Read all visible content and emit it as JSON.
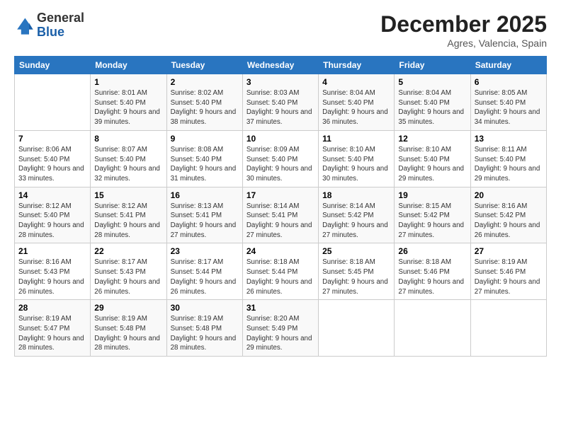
{
  "logo": {
    "general": "General",
    "blue": "Blue"
  },
  "header": {
    "month": "December 2025",
    "location": "Agres, Valencia, Spain"
  },
  "days_of_week": [
    "Sunday",
    "Monday",
    "Tuesday",
    "Wednesday",
    "Thursday",
    "Friday",
    "Saturday"
  ],
  "weeks": [
    [
      {
        "day": "",
        "sunrise": "",
        "sunset": "",
        "daylight": ""
      },
      {
        "day": "1",
        "sunrise": "8:01 AM",
        "sunset": "5:40 PM",
        "daylight": "9 hours and 39 minutes."
      },
      {
        "day": "2",
        "sunrise": "8:02 AM",
        "sunset": "5:40 PM",
        "daylight": "9 hours and 38 minutes."
      },
      {
        "day": "3",
        "sunrise": "8:03 AM",
        "sunset": "5:40 PM",
        "daylight": "9 hours and 37 minutes."
      },
      {
        "day": "4",
        "sunrise": "8:04 AM",
        "sunset": "5:40 PM",
        "daylight": "9 hours and 36 minutes."
      },
      {
        "day": "5",
        "sunrise": "8:04 AM",
        "sunset": "5:40 PM",
        "daylight": "9 hours and 35 minutes."
      },
      {
        "day": "6",
        "sunrise": "8:05 AM",
        "sunset": "5:40 PM",
        "daylight": "9 hours and 34 minutes."
      }
    ],
    [
      {
        "day": "7",
        "sunrise": "8:06 AM",
        "sunset": "5:40 PM",
        "daylight": "9 hours and 33 minutes."
      },
      {
        "day": "8",
        "sunrise": "8:07 AM",
        "sunset": "5:40 PM",
        "daylight": "9 hours and 32 minutes."
      },
      {
        "day": "9",
        "sunrise": "8:08 AM",
        "sunset": "5:40 PM",
        "daylight": "9 hours and 31 minutes."
      },
      {
        "day": "10",
        "sunrise": "8:09 AM",
        "sunset": "5:40 PM",
        "daylight": "9 hours and 30 minutes."
      },
      {
        "day": "11",
        "sunrise": "8:10 AM",
        "sunset": "5:40 PM",
        "daylight": "9 hours and 30 minutes."
      },
      {
        "day": "12",
        "sunrise": "8:10 AM",
        "sunset": "5:40 PM",
        "daylight": "9 hours and 29 minutes."
      },
      {
        "day": "13",
        "sunrise": "8:11 AM",
        "sunset": "5:40 PM",
        "daylight": "9 hours and 29 minutes."
      }
    ],
    [
      {
        "day": "14",
        "sunrise": "8:12 AM",
        "sunset": "5:40 PM",
        "daylight": "9 hours and 28 minutes."
      },
      {
        "day": "15",
        "sunrise": "8:12 AM",
        "sunset": "5:41 PM",
        "daylight": "9 hours and 28 minutes."
      },
      {
        "day": "16",
        "sunrise": "8:13 AM",
        "sunset": "5:41 PM",
        "daylight": "9 hours and 27 minutes."
      },
      {
        "day": "17",
        "sunrise": "8:14 AM",
        "sunset": "5:41 PM",
        "daylight": "9 hours and 27 minutes."
      },
      {
        "day": "18",
        "sunrise": "8:14 AM",
        "sunset": "5:42 PM",
        "daylight": "9 hours and 27 minutes."
      },
      {
        "day": "19",
        "sunrise": "8:15 AM",
        "sunset": "5:42 PM",
        "daylight": "9 hours and 27 minutes."
      },
      {
        "day": "20",
        "sunrise": "8:16 AM",
        "sunset": "5:42 PM",
        "daylight": "9 hours and 26 minutes."
      }
    ],
    [
      {
        "day": "21",
        "sunrise": "8:16 AM",
        "sunset": "5:43 PM",
        "daylight": "9 hours and 26 minutes."
      },
      {
        "day": "22",
        "sunrise": "8:17 AM",
        "sunset": "5:43 PM",
        "daylight": "9 hours and 26 minutes."
      },
      {
        "day": "23",
        "sunrise": "8:17 AM",
        "sunset": "5:44 PM",
        "daylight": "9 hours and 26 minutes."
      },
      {
        "day": "24",
        "sunrise": "8:18 AM",
        "sunset": "5:44 PM",
        "daylight": "9 hours and 26 minutes."
      },
      {
        "day": "25",
        "sunrise": "8:18 AM",
        "sunset": "5:45 PM",
        "daylight": "9 hours and 27 minutes."
      },
      {
        "day": "26",
        "sunrise": "8:18 AM",
        "sunset": "5:46 PM",
        "daylight": "9 hours and 27 minutes."
      },
      {
        "day": "27",
        "sunrise": "8:19 AM",
        "sunset": "5:46 PM",
        "daylight": "9 hours and 27 minutes."
      }
    ],
    [
      {
        "day": "28",
        "sunrise": "8:19 AM",
        "sunset": "5:47 PM",
        "daylight": "9 hours and 28 minutes."
      },
      {
        "day": "29",
        "sunrise": "8:19 AM",
        "sunset": "5:48 PM",
        "daylight": "9 hours and 28 minutes."
      },
      {
        "day": "30",
        "sunrise": "8:19 AM",
        "sunset": "5:48 PM",
        "daylight": "9 hours and 28 minutes."
      },
      {
        "day": "31",
        "sunrise": "8:20 AM",
        "sunset": "5:49 PM",
        "daylight": "9 hours and 29 minutes."
      },
      {
        "day": "",
        "sunrise": "",
        "sunset": "",
        "daylight": ""
      },
      {
        "day": "",
        "sunrise": "",
        "sunset": "",
        "daylight": ""
      },
      {
        "day": "",
        "sunrise": "",
        "sunset": "",
        "daylight": ""
      }
    ]
  ]
}
